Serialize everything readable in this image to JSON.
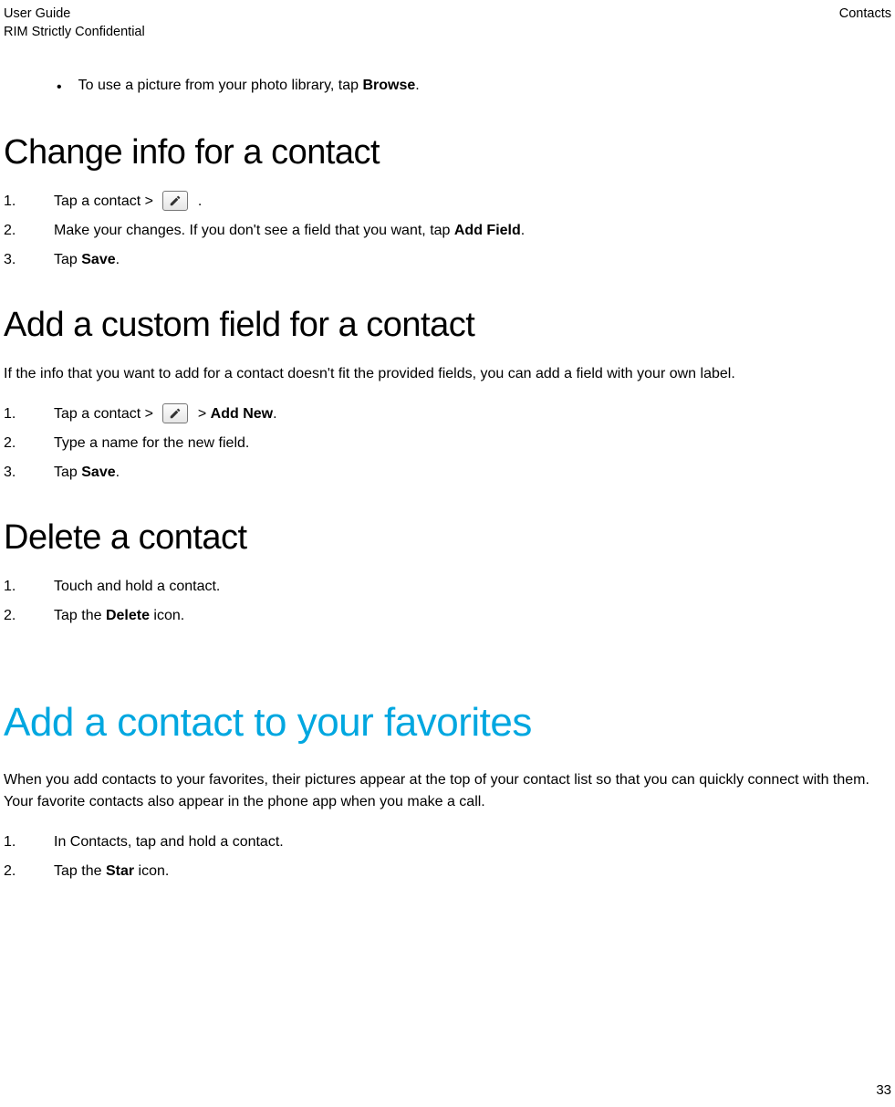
{
  "header": {
    "left_line1": "User Guide",
    "left_line2": "RIM Strictly Confidential",
    "right": "Contacts"
  },
  "intro_bullet": {
    "prefix": "To use a picture from your photo library, tap ",
    "bold": "Browse",
    "suffix": "."
  },
  "section1": {
    "title": "Change info for a contact",
    "step1_prefix": "Tap a contact > ",
    "step1_suffix": " .",
    "step2_prefix": "Make your changes. If you don't see a field that you want, tap ",
    "step2_bold": "Add Field",
    "step2_suffix": ".",
    "step3_prefix": "Tap ",
    "step3_bold": "Save",
    "step3_suffix": "."
  },
  "section2": {
    "title": "Add a custom field for a contact",
    "intro": "If the info that you want to add for a contact doesn't fit the provided fields, you can add a field with your own label.",
    "step1_prefix": "Tap a contact > ",
    "step1_mid": " > ",
    "step1_bold": "Add New",
    "step1_suffix": ".",
    "step2": "Type a name for the new field.",
    "step3_prefix": "Tap ",
    "step3_bold": "Save",
    "step3_suffix": "."
  },
  "section3": {
    "title": "Delete a contact",
    "step1": "Touch and hold a contact.",
    "step2_prefix": "Tap the ",
    "step2_bold": "Delete",
    "step2_suffix": " icon."
  },
  "section4": {
    "title": "Add a contact to your favorites",
    "intro": "When you add contacts to your favorites, their pictures appear at the top of your contact list so that you can quickly connect with them. Your favorite contacts also appear in the phone app when you make a call.",
    "step1": "In Contacts, tap and hold a contact.",
    "step2_prefix": "Tap the ",
    "step2_bold": "Star",
    "step2_suffix": " icon."
  },
  "page_number": "33"
}
